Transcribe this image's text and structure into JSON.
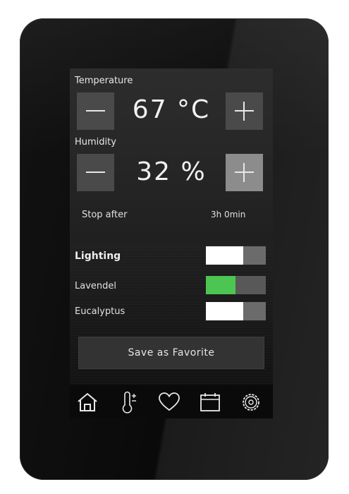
{
  "temperature": {
    "label": "Temperature",
    "value": "67 °C",
    "minus_icon": "minus-icon",
    "plus_icon": "plus-icon"
  },
  "humidity": {
    "label": "Humidity",
    "value": "32 %",
    "minus_icon": "minus-icon",
    "plus_icon": "plus-icon"
  },
  "timer": {
    "label": "Stop after",
    "value": "3h 0min"
  },
  "toggles": [
    {
      "label": "Lighting",
      "state": "off"
    },
    {
      "label": "Lavendel",
      "state": "on"
    },
    {
      "label": "Eucalyptus",
      "state": "off"
    }
  ],
  "favorite_button": {
    "label": "Save as Favorite"
  },
  "nav": [
    {
      "icon": "home-icon"
    },
    {
      "icon": "thermometer-icon"
    },
    {
      "icon": "heart-icon"
    },
    {
      "icon": "calendar-icon"
    },
    {
      "icon": "settings-icon"
    }
  ],
  "colors": {
    "accent_on": "#4cc552",
    "button_dark": "#4a4a4a",
    "button_light": "#8c8c8c",
    "screen_bg": "#242424"
  }
}
